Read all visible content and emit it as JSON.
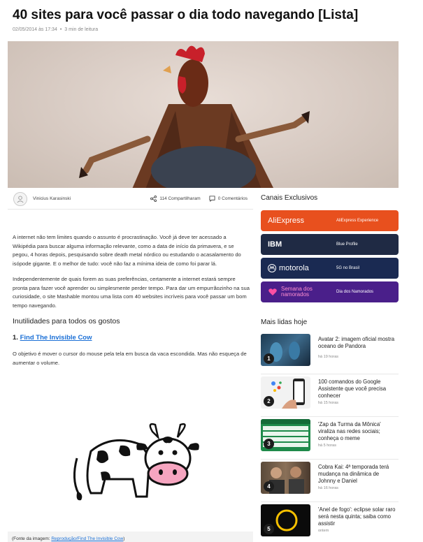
{
  "article": {
    "title": "40 sites para você passar o dia todo navegando [Lista]",
    "date": "02/05/2014 às 17:34",
    "read_time": "3 min de leitura",
    "author": "Vinicius Karasinski",
    "shares": "114 Compartilharam",
    "comments": "0 Comentários",
    "paragraphs": [
      "A internet não tem limites quando o assunto é procrastinação. Você já deve ter acessado a Wikipédia para buscar alguma informação relevante, como a data de início da primavera, e se pegou, 4 horas depois, pesquisando sobre death metal nórdico ou estudando o acasalamento do isópode gigante. E o melhor de tudo: você não faz a mínima ideia de como foi parar lá.",
      "Independentemente de quais forem as suas preferências, certamente a internet estará sempre pronta para fazer você aprender ou simplesmente perder tempo. Para dar um empurrãozinho na sua curiosidade, o site Mashable montou uma lista com 40 websites incríveis para você passar um bom tempo navegando."
    ],
    "section_title": "Inutilidades para todos os gostos",
    "item_number": "1.",
    "item_link": "Find The Invisible Cow",
    "item_text": "O objetivo é mover o cursor do mouse pela tela em busca da vaca escondida. Mas não esqueça de aumentar o volume.",
    "image_credit_prefix": "(Fonte da imagem: ",
    "image_credit_link": "Reprodução/Find The Invisible Cow",
    "image_credit_suffix": ")"
  },
  "sidebar": {
    "channels_title": "Canais Exclusivos",
    "channels": [
      {
        "brand": "AliExpress",
        "label": "AliExpress Experience",
        "color": "#e8501e"
      },
      {
        "brand": "IBM",
        "label": "Blue Profile",
        "color": "#1f2a44"
      },
      {
        "brand": "motorola",
        "label": "5G no Brasil",
        "color": "#1a2a52"
      },
      {
        "brand": "Semana dos namorados",
        "label": "Dia dos Namorados",
        "color": "#4a1f8a"
      }
    ],
    "most_read_title": "Mais lidas hoje",
    "most_read": [
      {
        "num": "1",
        "title": "Avatar 2: imagem oficial mostra oceano de Pandora",
        "time": "há 19 horas"
      },
      {
        "num": "2",
        "title": "100 comandos do Google Assistente que você precisa conhecer",
        "time": "há 15 horas"
      },
      {
        "num": "3",
        "title": "'Zap da Turma da Mônica' viraliza nas redes sociais; conheça o meme",
        "time": "há 5 horas"
      },
      {
        "num": "4",
        "title": "Cobra Kai: 4ª temporada terá mudança na dinâmica de Johnny e Daniel",
        "time": "há 16 horas"
      },
      {
        "num": "5",
        "title": "'Anel de fogo': eclipse solar raro será nesta quinta; saiba como assistir",
        "time": "ontem"
      }
    ]
  }
}
